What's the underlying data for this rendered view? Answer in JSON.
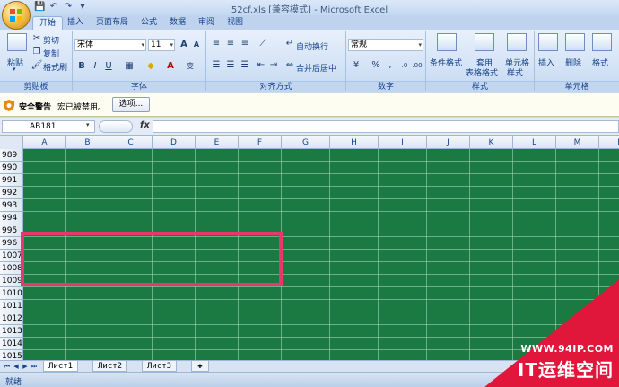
{
  "window": {
    "title": "52cf.xls  [兼容模式] - Microsoft Excel"
  },
  "qat": {
    "save": "💾",
    "undo": "↶",
    "redo": "↷"
  },
  "tabs": [
    "开始",
    "插入",
    "页面布局",
    "公式",
    "数据",
    "审阅",
    "视图"
  ],
  "clipboard": {
    "paste": "粘贴",
    "cut": "剪切",
    "copy": "复制",
    "format_painter": "格式刷",
    "group": "剪贴板"
  },
  "font": {
    "name": "宋体",
    "size": "11",
    "bold": "B",
    "italic": "I",
    "underline": "U",
    "phonetic": "wén",
    "group": "字体"
  },
  "alignment": {
    "wrap": "自动换行",
    "merge": "合并后居中",
    "group": "对齐方式"
  },
  "number": {
    "format": "常规",
    "percent": "%",
    "comma": ",",
    "group": "数字"
  },
  "styles": {
    "conditional": "条件格式",
    "table_line1": "套用",
    "table_line2": "表格格式",
    "cell_line1": "单元格",
    "cell_line2": "样式",
    "group": "样式"
  },
  "cells": {
    "insert": "插入",
    "delete": "删除",
    "format": "格式",
    "group": "单元格"
  },
  "security": {
    "title": "安全警告",
    "message": "宏已被禁用。",
    "options_button": "选项..."
  },
  "formula_bar": {
    "name_box": "AB181",
    "fx": "fx",
    "formula": ""
  },
  "columns": [
    "A",
    "B",
    "C",
    "D",
    "E",
    "F",
    "G",
    "H",
    "I",
    "J",
    "K",
    "L",
    "M",
    "N"
  ],
  "rows": [
    "989",
    "990",
    "991",
    "992",
    "993",
    "994",
    "995",
    "996",
    "1007",
    "1008",
    "1009",
    "1010",
    "1011",
    "1012",
    "1013",
    "1014",
    "1015"
  ],
  "sheets": [
    "Лист1",
    "Лист2",
    "Лист3"
  ],
  "status": {
    "text": "就绪"
  },
  "watermark": {
    "url": "WWW.94IP.COM",
    "brand": "IT运维空间"
  },
  "colors": {
    "grid_fill": "#1b7a41",
    "highlight": "#e7386e",
    "watermark": "#e0163a"
  }
}
